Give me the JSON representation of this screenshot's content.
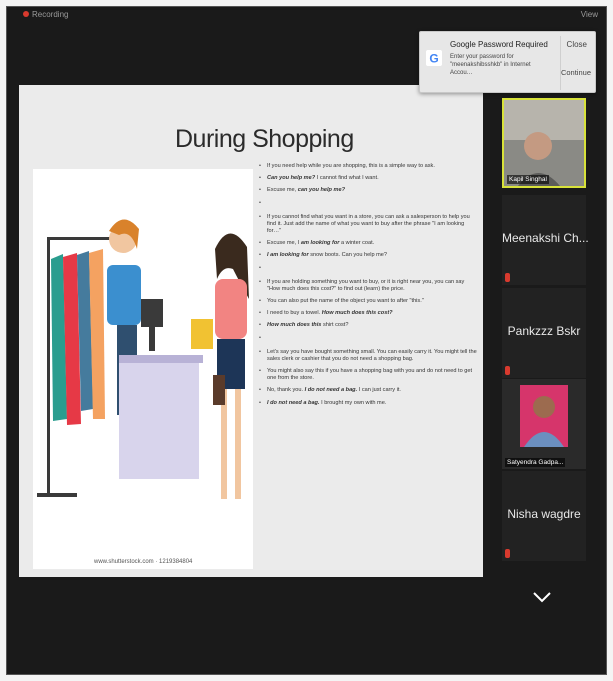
{
  "topbar": {
    "recording_label": "Recording",
    "view_label": "View"
  },
  "popup": {
    "title": "Google Password Required",
    "body": "Enter your password for \"meenakshibsshkb\" in Internet Accou…",
    "close_label": "Close",
    "continue_label": "Continue"
  },
  "slide": {
    "title": "During Shopping",
    "image_caption": "www.shutterstock.com · 1219384804",
    "bullets": [
      {
        "pre": "If you need help while you are shopping, this is a simple way to ask.",
        "em": "",
        "post": ""
      },
      {
        "pre": "",
        "em": "Can you help me?",
        "post": " I cannot find what I want."
      },
      {
        "pre": "Excuse me, ",
        "em": "can you help me?",
        "post": ""
      },
      {
        "pre": "",
        "em": "",
        "post": ""
      },
      {
        "pre": "If you cannot find what you want in a store, you can ask a salesperson to help you find it. Just add the name of what you want to buy after the phrase \"I am looking for…\"",
        "em": "",
        "post": ""
      },
      {
        "pre": "Excuse me, I ",
        "em": "am looking for",
        "post": " a winter coat."
      },
      {
        "pre": "",
        "em": "I am looking for",
        "post": " snow boots. Can you help me?"
      },
      {
        "pre": "",
        "em": "",
        "post": ""
      },
      {
        "pre": "If you are holding something you want to buy, or it is right near you, you can say \"How much does this cost?\" to find out (learn) the price.",
        "em": "",
        "post": ""
      },
      {
        "pre": "You can also put the name of the object you want to after \"this.\"",
        "em": "",
        "post": ""
      },
      {
        "pre": "I need to buy a towel. ",
        "em": "How much does this cost?",
        "post": ""
      },
      {
        "pre": "",
        "em": "How much does this",
        "post": " shirt cost?"
      },
      {
        "pre": "",
        "em": "",
        "post": ""
      },
      {
        "pre": "Let's say you have bought something small. You can easily carry it. You might tell the sales clerk or cashier that you do not need a shopping bag.",
        "em": "",
        "post": ""
      },
      {
        "pre": "You might also say this if you have a shopping bag with you and do not need to get one from the store.",
        "em": "",
        "post": ""
      },
      {
        "pre": "No, thank you. ",
        "em": "I do not need a bag.",
        "post": " I can just carry it."
      },
      {
        "pre": "",
        "em": "I do not need a bag.",
        "post": " I brought my own with me."
      }
    ]
  },
  "participants": [
    {
      "name": "Kapil Singhal",
      "video": true
    },
    {
      "name": "Meenakshi Ch...",
      "video": false
    },
    {
      "name": "Pankzzz Bskr",
      "video": false
    },
    {
      "name": "Satyendra Gadpa...",
      "video": true
    },
    {
      "name": "Nisha wagdre",
      "video": false
    }
  ],
  "colors": {
    "active_speaker_border": "#d8e23a",
    "mic_muted": "#d83a2e",
    "google_blue": "#4285f4"
  },
  "icons": {
    "mic_off": "mic-off-icon",
    "more": "chevron-down-icon",
    "google": "google-g-icon"
  }
}
